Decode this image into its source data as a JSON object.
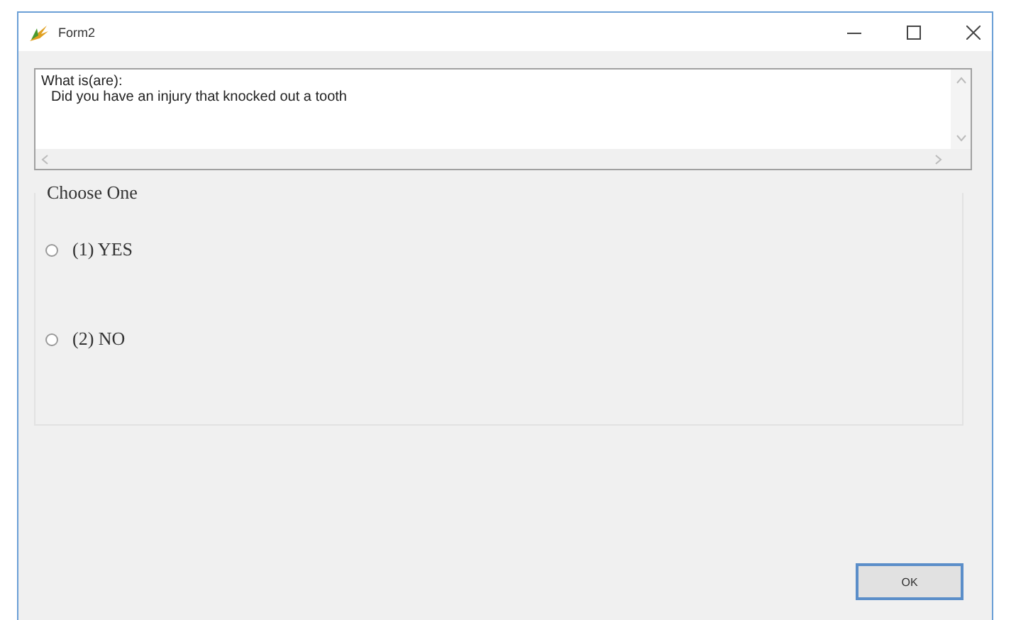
{
  "window": {
    "title": "Form2"
  },
  "question": {
    "lines": [
      "What is(are):",
      "Did you have an injury that knocked out a tooth"
    ]
  },
  "group": {
    "title": "Choose One",
    "options": [
      {
        "label": "(1) YES",
        "selected": false
      },
      {
        "label": "(2) NO",
        "selected": false
      }
    ]
  },
  "buttons": [
    "OK"
  ]
}
